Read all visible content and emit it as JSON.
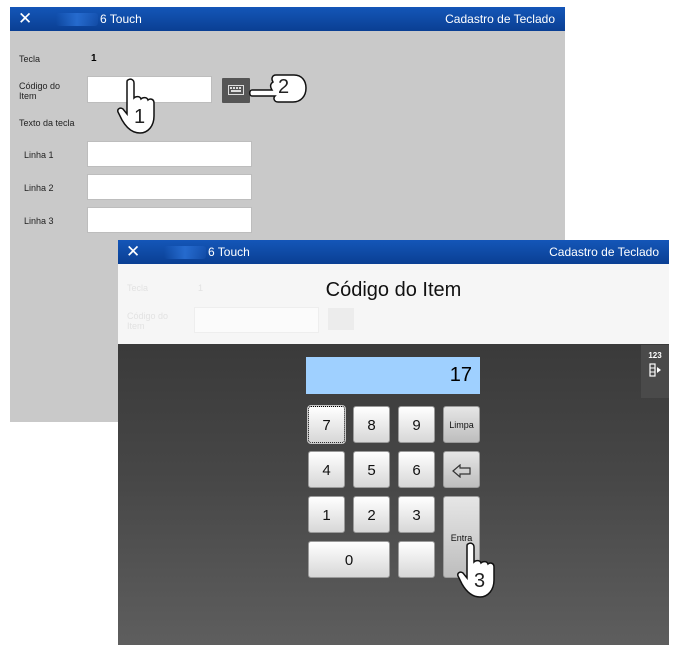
{
  "background_window": {
    "title_close": "✕",
    "app_name": "6 Touch",
    "screen_title": "Cadastro de Teclado",
    "fields": {
      "tecla_label": "Tecla",
      "tecla_value": "1",
      "codigo_label": "Código do Item",
      "texto_label": "Texto da tecla",
      "linha1_label": "Linha 1",
      "linha2_label": "Linha 2",
      "linha3_label": "Linha 3",
      "codigo_value": "",
      "linha1_value": "",
      "linha2_value": "",
      "linha3_value": ""
    }
  },
  "callouts": {
    "step1": "1",
    "step2": "2",
    "step3": "3"
  },
  "foreground_window": {
    "title_close": "✕",
    "app_name": "6 Touch",
    "screen_title": "Cadastro de Teclado",
    "ghost": {
      "tecla_label": "Tecla",
      "tecla_value": "1",
      "codigo_label": "Código do Item"
    },
    "dialog_title": "Código do Item",
    "display_value": "17",
    "side_tab_label": "123",
    "keys": {
      "k7": "7",
      "k8": "8",
      "k9": "9",
      "limpa": "Limpa",
      "k4": "4",
      "k5": "5",
      "k6": "6",
      "k1": "1",
      "k2": "2",
      "k3": "3",
      "entra": "Entra",
      "k0": "0",
      "blank": ""
    }
  },
  "colors": {
    "titlebar": "#0a3f93",
    "display": "#9fd0ff",
    "background_window": "#c9c9c9",
    "keypad_area": "#474747"
  }
}
